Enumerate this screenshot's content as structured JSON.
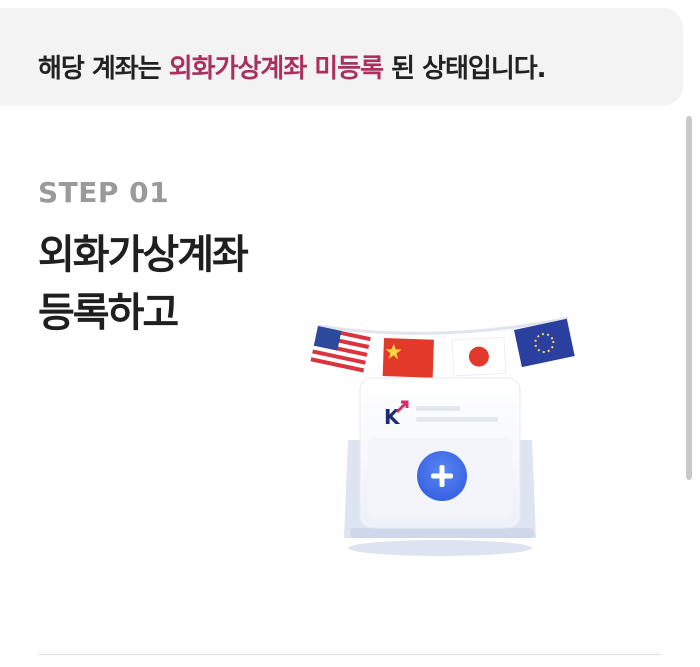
{
  "notice": {
    "prefix": "해당 계좌는 ",
    "highlight": "외화가상계좌 미등록",
    "suffix": " 된 상태입니다.",
    "highlight_color": "#a8315d"
  },
  "step": {
    "label": "STEP 01",
    "title_line1": "외화가상계좌",
    "title_line2": "등록하고"
  },
  "illustration": {
    "flags": [
      "us-flag-icon",
      "china-flag-icon",
      "japan-flag-icon",
      "eu-flag-icon"
    ],
    "add_button_icon": "plus-icon",
    "brand_icon": "k-logo-icon",
    "accent_color": "#3f6ee8"
  }
}
